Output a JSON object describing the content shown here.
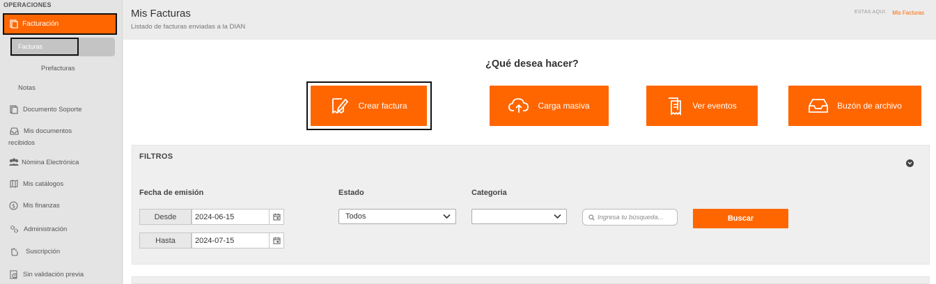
{
  "sidebar": {
    "section_title": "OPERACIONES",
    "active_item": "Facturación",
    "sub_items": [
      "Facturas",
      "Prefacturas",
      "Notas"
    ],
    "items": [
      {
        "label": "Documento Soporte",
        "icon": "document-icon"
      },
      {
        "label": "Mis documentos recibidos",
        "icon": "inbox-icon"
      },
      {
        "label": "Nómina Electrónica",
        "icon": "users-icon"
      },
      {
        "label": "Mis catálogos",
        "icon": "map-icon"
      },
      {
        "label": "Mis finanzas",
        "icon": "dollar-icon"
      },
      {
        "label": "Administración",
        "icon": "gears-icon"
      },
      {
        "label": "Suscripción",
        "icon": "hand-icon"
      },
      {
        "label": "Sin validación previa",
        "icon": "clock-doc-icon"
      }
    ],
    "mis_documentos_line1": "Mis documentos",
    "mis_documentos_line2": "recibidos"
  },
  "header": {
    "title": "Mis Facturas",
    "subtitle": "Listado de facturas enviadas a la DIAN",
    "breadcrumb_label": "ESTAS AQUI:",
    "breadcrumb_link": "Mis Facturas"
  },
  "main": {
    "question": "¿Qué desea hacer?",
    "actions": [
      {
        "label": "Crear factura",
        "icon": "edit-doc-icon"
      },
      {
        "label": "Carga masiva",
        "icon": "cloud-upload-icon"
      },
      {
        "label": "Ver eventos",
        "icon": "documents-icon"
      },
      {
        "label": "Buzón de archivo",
        "icon": "inbox-tray-icon"
      }
    ]
  },
  "filters": {
    "title": "FILTROS",
    "fecha_label": "Fecha de emisión",
    "desde_label": "Desde",
    "desde_value": "2024-06-15",
    "hasta_label": "Hasta",
    "hasta_value": "2024-07-15",
    "estado_label": "Estado",
    "estado_value": "Todos",
    "categoria_label": "Categoria",
    "categoria_value": "",
    "search_placeholder": "Ingresa tu búsqueda...",
    "search_button": "Buscar"
  },
  "colors": {
    "accent": "#ff6600",
    "sidebar_bg": "#e4e4e4",
    "page_bg": "#ececec"
  }
}
